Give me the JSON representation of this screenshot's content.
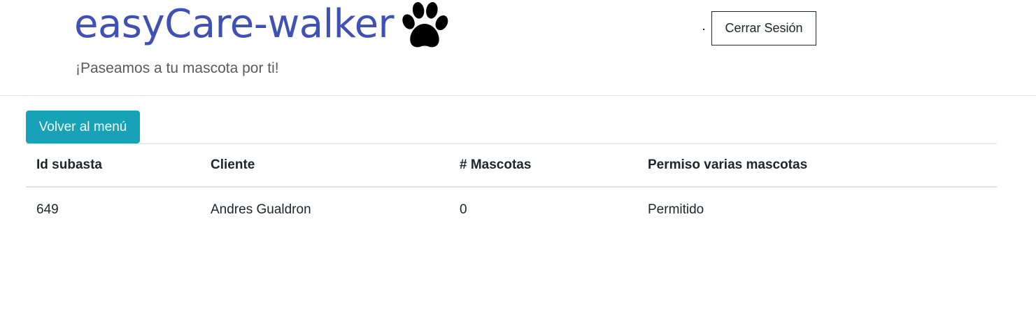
{
  "header": {
    "brand": "easyCare-walker",
    "paw_icon": "paw-icon",
    "tagline": "¡Paseamos a tu mascota por ti!",
    "logout_label": "Cerrar Sesión",
    "separator": "·"
  },
  "actions": {
    "back_label": "Volver al menú"
  },
  "colors": {
    "brand": "#3f51b5",
    "back_button": "#17a2b8"
  },
  "table": {
    "columns": [
      "Id subasta",
      "Cliente",
      "# Mascotas",
      "Permiso varias mascotas"
    ],
    "rows": [
      [
        "649",
        "Andres Gualdron",
        "0",
        "Permitido"
      ]
    ]
  }
}
